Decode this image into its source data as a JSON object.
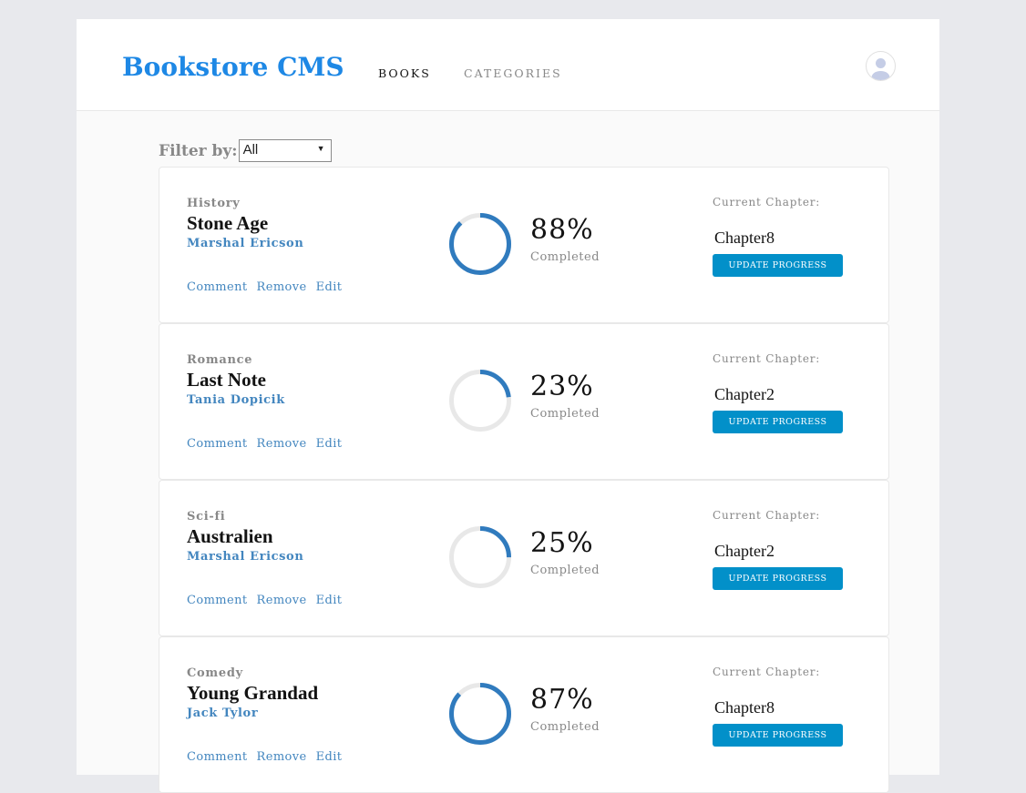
{
  "header": {
    "brand": "Bookstore CMS",
    "nav": [
      {
        "label": "BOOKS",
        "active": true
      },
      {
        "label": "CATEGORIES",
        "active": false
      }
    ],
    "avatar_icon": "user-icon"
  },
  "filter": {
    "label": "Filter by:",
    "selected": "All"
  },
  "books": [
    {
      "category": "History",
      "title": "Stone Age",
      "author": "Marshal Ericson",
      "progress": 88,
      "percent_label": "88%",
      "completed_label": "Completed",
      "current_chapter_label": "Current Chapter:",
      "chapter": "Chapter8",
      "update_label": "UPDATE PROGRESS",
      "actions": [
        "Comment",
        "Remove",
        "Edit"
      ]
    },
    {
      "category": "Romance",
      "title": "Last Note",
      "author": "Tania Dopicik",
      "progress": 23,
      "percent_label": "23%",
      "completed_label": "Completed",
      "current_chapter_label": "Current Chapter:",
      "chapter": "Chapter2",
      "update_label": "UPDATE PROGRESS",
      "actions": [
        "Comment",
        "Remove",
        "Edit"
      ]
    },
    {
      "category": "Sci-fi",
      "title": "Australien",
      "author": "Marshal Ericson",
      "progress": 25,
      "percent_label": "25%",
      "completed_label": "Completed",
      "current_chapter_label": "Current Chapter:",
      "chapter": "Chapter2",
      "update_label": "UPDATE PROGRESS",
      "actions": [
        "Comment",
        "Remove",
        "Edit"
      ]
    },
    {
      "category": "Comedy",
      "title": "Young Grandad",
      "author": "Jack Tylor",
      "progress": 87,
      "percent_label": "87%",
      "completed_label": "Completed",
      "current_chapter_label": "Current Chapter:",
      "chapter": "Chapter8",
      "update_label": "UPDATE PROGRESS",
      "actions": [
        "Comment",
        "Remove",
        "Edit"
      ]
    }
  ],
  "colors": {
    "brand": "#1e88e5",
    "accent_button": "#0290c9",
    "progress_ring": "#307bbe",
    "progress_track": "#e8e8e8",
    "link": "#4386bf"
  }
}
